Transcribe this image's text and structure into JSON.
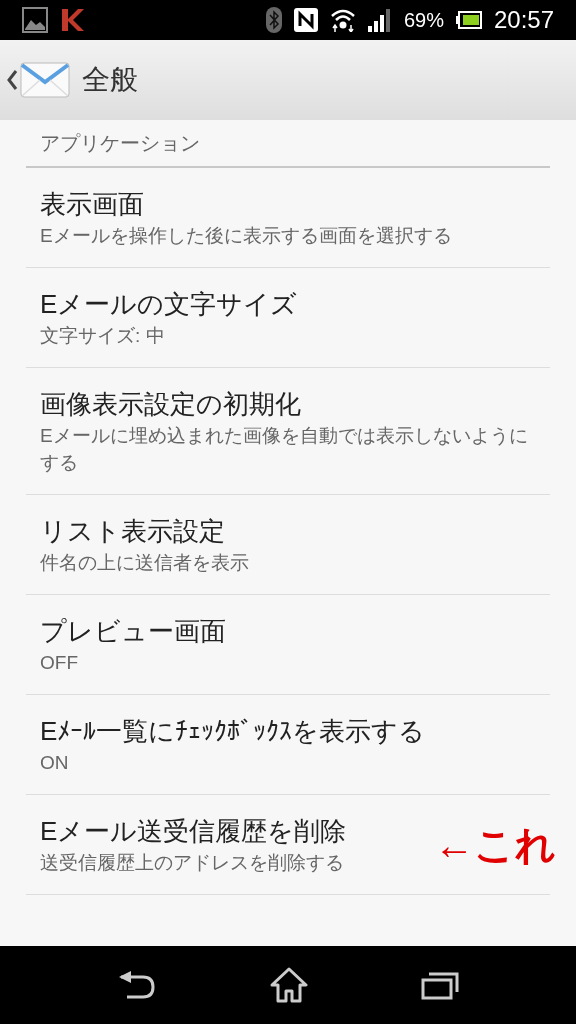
{
  "status_bar": {
    "battery_text": "69%",
    "time": "20:57"
  },
  "header": {
    "title": "全般"
  },
  "section": {
    "title": "アプリケーション"
  },
  "items": [
    {
      "title": "表示画面",
      "summary": "Eメールを操作した後に表示する画面を選択する"
    },
    {
      "title": "Eメールの文字サイズ",
      "summary": "文字サイズ: 中"
    },
    {
      "title": "画像表示設定の初期化",
      "summary": "Eメールに埋め込まれた画像を自動では表示しないようにする"
    },
    {
      "title": "リスト表示設定",
      "summary": "件名の上に送信者を表示"
    },
    {
      "title": "プレビュー画面",
      "summary": "OFF"
    },
    {
      "title": "Eﾒｰﾙ一覧にﾁｪｯｸﾎﾞｯｸｽを表示する",
      "summary": "ON"
    },
    {
      "title": "Eメール送受信履歴を削除",
      "summary": "送受信履歴上のアドレスを削除する",
      "annotation": "←これ"
    }
  ]
}
